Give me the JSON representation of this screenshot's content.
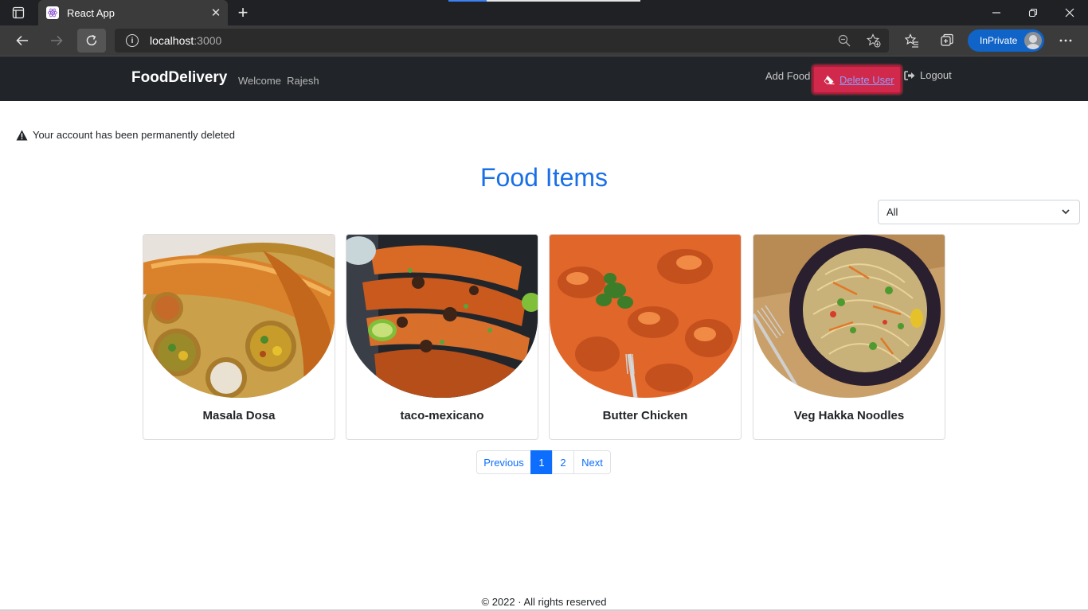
{
  "browser": {
    "tab_title": "React App",
    "url_host": "localhost",
    "url_port": ":3000",
    "inprivate_label": "InPrivate"
  },
  "navbar": {
    "brand": "FoodDelivery",
    "welcome": "Welcome  Rajesh",
    "add_food": "Add Food",
    "delete_user": "Delete User",
    "logout": "Logout"
  },
  "alert": {
    "message": "Your account has been permanently deleted"
  },
  "main": {
    "heading": "Food Items",
    "filter_selected": "All",
    "items": [
      {
        "name": "Masala Dosa"
      },
      {
        "name": "taco-mexicano"
      },
      {
        "name": "Butter Chicken"
      },
      {
        "name": "Veg Hakka Noodles"
      }
    ]
  },
  "pagination": {
    "previous": "Previous",
    "pages": [
      "1",
      "2"
    ],
    "active_page": "1",
    "next": "Next"
  },
  "footer": {
    "text": "© 2022 · All rights reserved"
  },
  "colors": {
    "accent": "#0d6efd",
    "heading": "#1a6fe8",
    "navbar_bg": "#212529",
    "danger": "#d1294b"
  }
}
